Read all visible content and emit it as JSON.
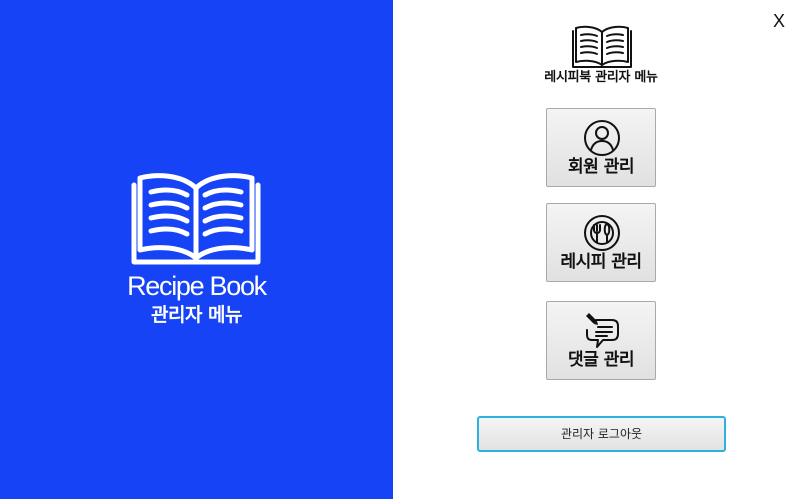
{
  "left_panel": {
    "background_color": "#1543f5",
    "logo_icon": "open-book-icon",
    "brand_title": "Recipe Book",
    "brand_subtitle": "관리자 메뉴"
  },
  "window": {
    "close_label": "X"
  },
  "side_header": {
    "icon": "open-book-icon",
    "title": "레시피북 관리자 메뉴"
  },
  "menu": [
    {
      "icon": "user-circle-icon",
      "label": "회원 관리"
    },
    {
      "icon": "utensils-plate-icon",
      "label": "레시피 관리"
    },
    {
      "icon": "comment-edit-icon",
      "label": "댓글 관리"
    }
  ],
  "logout_label": "관리자 로그아웃",
  "accent_color": "#2fb1e0"
}
